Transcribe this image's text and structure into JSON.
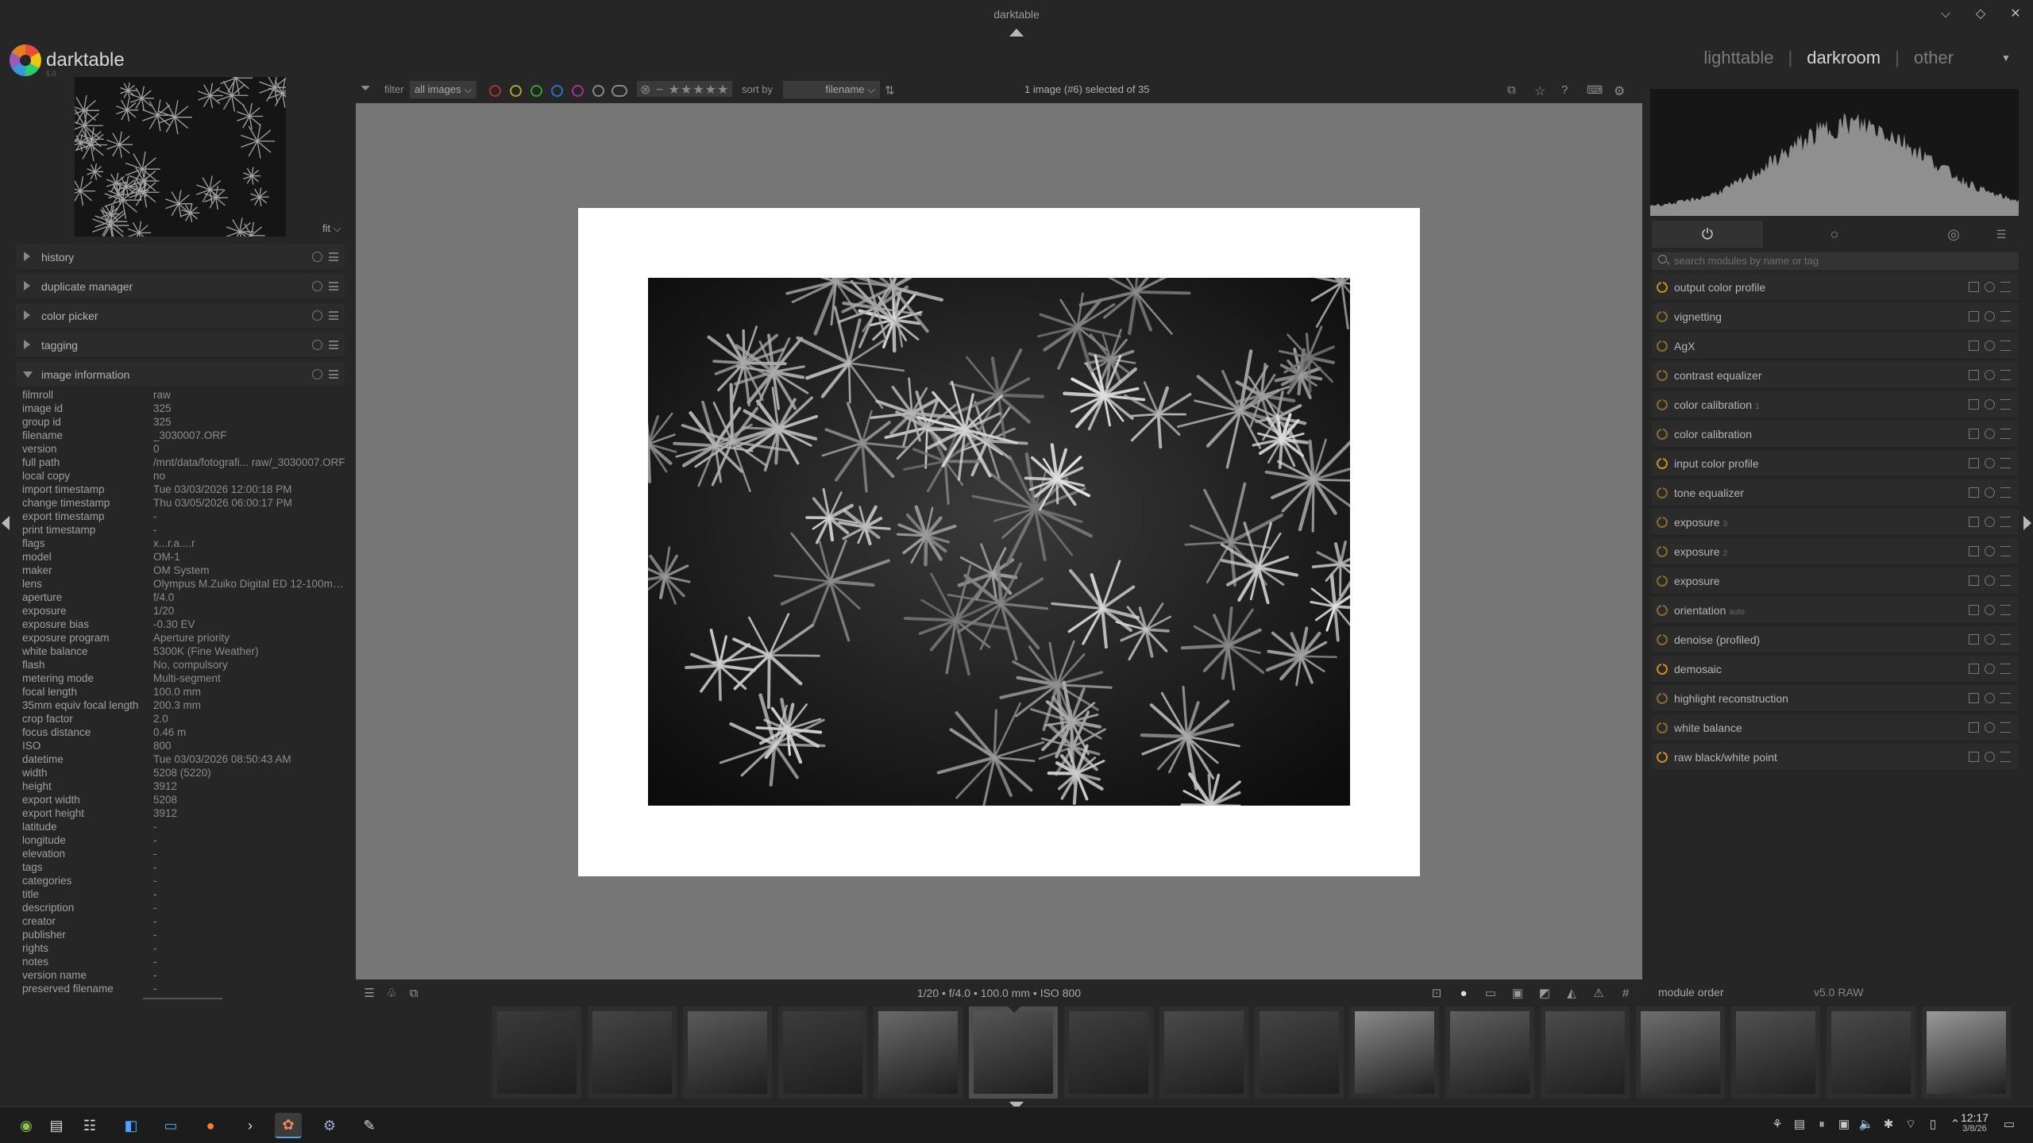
{
  "window": {
    "title": "darktable"
  },
  "app": {
    "name": "darktable",
    "version_small": "5.0"
  },
  "views": {
    "lighttable": "lighttable",
    "darkroom": "darkroom",
    "other": "other",
    "sep": "|"
  },
  "navigator": {
    "zoom": "fit"
  },
  "left_modules": [
    {
      "label": "history"
    },
    {
      "label": "duplicate manager"
    },
    {
      "label": "color picker"
    },
    {
      "label": "tagging"
    },
    {
      "label": "image information"
    }
  ],
  "image_info": [
    {
      "k": "filmroll",
      "v": "raw"
    },
    {
      "k": "image id",
      "v": "325"
    },
    {
      "k": "group id",
      "v": "325"
    },
    {
      "k": "filename",
      "v": "_3030007.ORF"
    },
    {
      "k": "version",
      "v": "0"
    },
    {
      "k": "full path",
      "v": "/mnt/data/fotografi... raw/_3030007.ORF"
    },
    {
      "k": "local copy",
      "v": "no"
    },
    {
      "k": "import timestamp",
      "v": "Tue 03/03/2026 12:00:18 PM"
    },
    {
      "k": "change timestamp",
      "v": "Thu 03/05/2026 06:00:17 PM"
    },
    {
      "k": "export timestamp",
      "v": "-"
    },
    {
      "k": "print timestamp",
      "v": "-"
    },
    {
      "k": "flags",
      "v": "x...r.a....r"
    },
    {
      "k": "model",
      "v": "OM-1"
    },
    {
      "k": "maker",
      "v": "OM System"
    },
    {
      "k": "lens",
      "v": "Olympus M.Zuiko Digital ED 12-100mm..."
    },
    {
      "k": "aperture",
      "v": "f/4.0"
    },
    {
      "k": "exposure",
      "v": "1/20"
    },
    {
      "k": "exposure bias",
      "v": "-0.30 EV"
    },
    {
      "k": "exposure program",
      "v": "Aperture priority"
    },
    {
      "k": "white balance",
      "v": "5300K (Fine Weather)"
    },
    {
      "k": "flash",
      "v": "No, compulsory"
    },
    {
      "k": "metering mode",
      "v": "Multi-segment"
    },
    {
      "k": "focal length",
      "v": "100.0 mm"
    },
    {
      "k": "35mm equiv focal length",
      "v": "200.3 mm"
    },
    {
      "k": "crop factor",
      "v": "2.0"
    },
    {
      "k": "focus distance",
      "v": "0.46 m"
    },
    {
      "k": "ISO",
      "v": "800"
    },
    {
      "k": "datetime",
      "v": "Tue 03/03/2026 08:50:43 AM"
    },
    {
      "k": "width",
      "v": "5208 (5220)"
    },
    {
      "k": "height",
      "v": "3912"
    },
    {
      "k": "export width",
      "v": "5208"
    },
    {
      "k": "export height",
      "v": "3912"
    },
    {
      "k": "latitude",
      "v": "-"
    },
    {
      "k": "longitude",
      "v": "-"
    },
    {
      "k": "elevation",
      "v": "-"
    },
    {
      "k": "tags",
      "v": "-"
    },
    {
      "k": "categories",
      "v": "-"
    },
    {
      "k": "title",
      "v": "-"
    },
    {
      "k": "description",
      "v": "-"
    },
    {
      "k": "creator",
      "v": "-"
    },
    {
      "k": "publisher",
      "v": "-"
    },
    {
      "k": "rights",
      "v": "-"
    },
    {
      "k": "notes",
      "v": "-"
    },
    {
      "k": "version name",
      "v": "-"
    },
    {
      "k": "preserved filename",
      "v": "-"
    }
  ],
  "filterbar": {
    "filter_label": "filter",
    "filter_value": "all images",
    "sort_label": "sort by",
    "sort_value": "filename",
    "selection": "1 image (#6) selected of 35",
    "stars": "⊗ − ★★★★★"
  },
  "color_labels": [
    "#b03030",
    "#b0a030",
    "#30a030",
    "#3070c0",
    "#a030a0",
    "#888888"
  ],
  "bottombar": {
    "exif": "1/20 • f/4.0 • 100.0 mm • ISO 800"
  },
  "right_search": {
    "placeholder": "search modules by name or tag"
  },
  "module_tabs": [
    "⏻",
    "○",
    "◎"
  ],
  "right_modules": [
    {
      "label": "output color profile",
      "inst": "",
      "on": true
    },
    {
      "label": "vignetting",
      "inst": "",
      "on": false
    },
    {
      "label": "AgX",
      "inst": "",
      "on": false
    },
    {
      "label": "contrast equalizer",
      "inst": "",
      "on": false
    },
    {
      "label": "color calibration",
      "inst": "1",
      "on": false
    },
    {
      "label": "color calibration",
      "inst": "",
      "on": false
    },
    {
      "label": "input color profile",
      "inst": "",
      "on": true
    },
    {
      "label": "tone equalizer",
      "inst": "",
      "on": false
    },
    {
      "label": "exposure",
      "inst": "3",
      "on": false
    },
    {
      "label": "exposure",
      "inst": "2",
      "on": false
    },
    {
      "label": "exposure",
      "inst": "",
      "on": false
    },
    {
      "label": "orientation",
      "inst": "auto",
      "on": false
    },
    {
      "label": "denoise (profiled)",
      "inst": "",
      "on": false
    },
    {
      "label": "demosaic",
      "inst": "",
      "on": true
    },
    {
      "label": "highlight reconstruction",
      "inst": "",
      "on": false
    },
    {
      "label": "white balance",
      "inst": "",
      "on": false
    },
    {
      "label": "raw black/white point",
      "inst": "",
      "on": true
    }
  ],
  "module_order": {
    "label": "module order",
    "value": "v5.0 RAW"
  },
  "filmstrip": {
    "count": 16,
    "selected_index": 5,
    "tones": [
      "#3a3a3a",
      "#454545",
      "#5a5a5a",
      "#3c3c3c",
      "#6a6a6a",
      "#555555",
      "#3f3f3f",
      "#4a4a4a",
      "#444444",
      "#8a8a8a",
      "#5e5e5e",
      "#4c4c4c",
      "#6f6f6f",
      "#515151",
      "#4a4a4a",
      "#9a9a9a"
    ]
  },
  "taskbar": {
    "time": "12:17",
    "date": "3/8/26"
  }
}
